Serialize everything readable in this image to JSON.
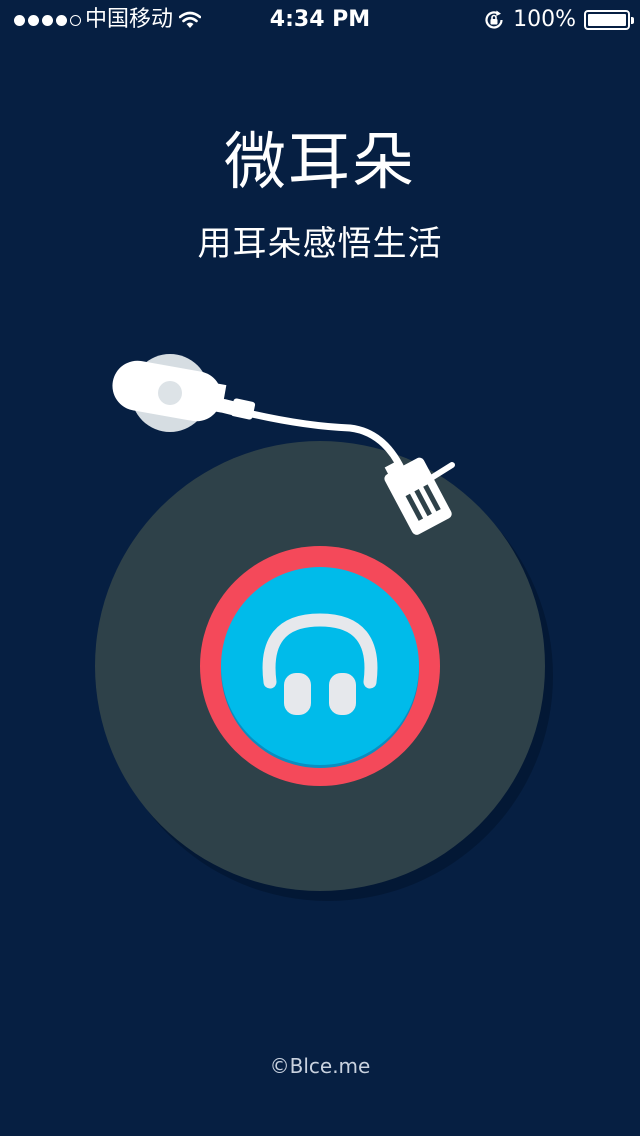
{
  "status_bar": {
    "signal_dots_filled": 4,
    "signal_dots_total": 5,
    "carrier": "中国移动",
    "wifi_icon": "wifi-icon",
    "time": "4:34 PM",
    "rotation_lock_icon": "rotation-lock-icon",
    "battery_percent": "100%",
    "battery_level": 1.0
  },
  "splash": {
    "title": "微耳朵",
    "subtitle": "用耳朵感悟生活",
    "graphic_icon": "turntable-headphones-icon",
    "copyright": "©Blce.me"
  },
  "colors": {
    "background": "#061f42",
    "record": "#2e4149",
    "label_ring": "#f4495a",
    "label_center": "#00bbea",
    "tonearm": "#ffffff"
  }
}
